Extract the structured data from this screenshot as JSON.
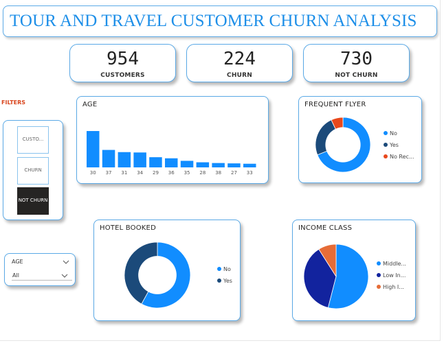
{
  "title": "TOUR AND TRAVEL CUSTOMER CHURN ANALYSIS",
  "kpis": [
    {
      "value": "954",
      "label": "CUSTOMERS"
    },
    {
      "value": "224",
      "label": "CHURN"
    },
    {
      "value": "730",
      "label": "NOT CHURN"
    }
  ],
  "filters": {
    "label": "FILTERS",
    "buttons": [
      {
        "label": "CUSTO...",
        "active": false
      },
      {
        "label": "CHURN",
        "active": false
      },
      {
        "label": "NOT CHURN",
        "active": true
      }
    ],
    "age_slicer": {
      "label": "AGE",
      "value": "All"
    }
  },
  "colors": {
    "accent": "#1e8fe8",
    "bar": "#118dff",
    "dark_blue": "#12239e",
    "navy": "#1b4a7a",
    "orange": "#e66c37",
    "red": "#e8481c",
    "filter_red": "#d9461e"
  },
  "chart_data": [
    {
      "id": "age",
      "type": "bar",
      "title": "AGE",
      "categories": [
        "30",
        "37",
        "31",
        "34",
        "29",
        "36",
        "35",
        "28",
        "38",
        "27",
        "33"
      ],
      "values": [
        100,
        48,
        42,
        41,
        28,
        25,
        18,
        14,
        12,
        11,
        10
      ],
      "ylim": [
        0,
        100
      ],
      "grid": false
    },
    {
      "id": "frequent_flyer",
      "type": "pie",
      "title": "FREQUENT FLYER",
      "donut": true,
      "labels": [
        "No",
        "Yes",
        "No Rec..."
      ],
      "values": [
        69,
        24,
        7
      ],
      "colors": [
        "#118dff",
        "#1b4a7a",
        "#e8481c"
      ],
      "legend": "right"
    },
    {
      "id": "hotel_booked",
      "type": "pie",
      "title": "HOTEL BOOKED",
      "donut": true,
      "labels": [
        "No",
        "Yes"
      ],
      "values": [
        58,
        42
      ],
      "colors": [
        "#118dff",
        "#1b4a7a"
      ],
      "legend": "right"
    },
    {
      "id": "income_class",
      "type": "pie",
      "title": "INCOME CLASS",
      "donut": false,
      "labels": [
        "Middle...",
        "Low In...",
        "High I..."
      ],
      "values": [
        54,
        37,
        9
      ],
      "colors": [
        "#118dff",
        "#12239e",
        "#e66c37"
      ],
      "legend": "right"
    }
  ]
}
